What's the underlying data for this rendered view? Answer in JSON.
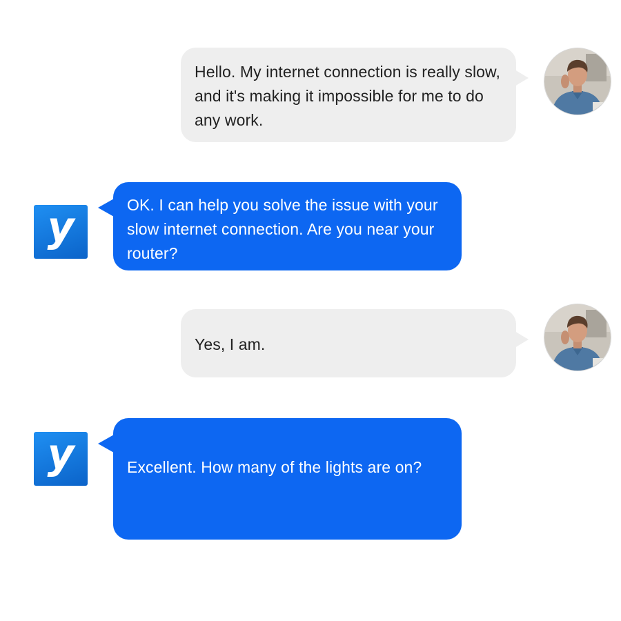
{
  "conversation": {
    "messages": [
      {
        "sender": "user",
        "text": "Hello. My internet connection is really slow, and it's making it impossible for me to do any work."
      },
      {
        "sender": "bot",
        "text": "OK. I can help you solve the issue with your slow internet connection. Are you near your router?"
      },
      {
        "sender": "user",
        "text": "Yes, I am."
      },
      {
        "sender": "bot",
        "text": "Excellent. How many of the lights are on?"
      }
    ]
  },
  "bot": {
    "logo_letter": "y",
    "logo_icon": "bot-logo-icon"
  },
  "user": {
    "avatar_icon": "user-avatar-photo"
  },
  "colors": {
    "bot_bubble": "#0d67f2",
    "user_bubble": "#eeeeee",
    "bot_logo": "#1a86ec",
    "bot_text": "#ffffff",
    "user_text": "#222222"
  }
}
